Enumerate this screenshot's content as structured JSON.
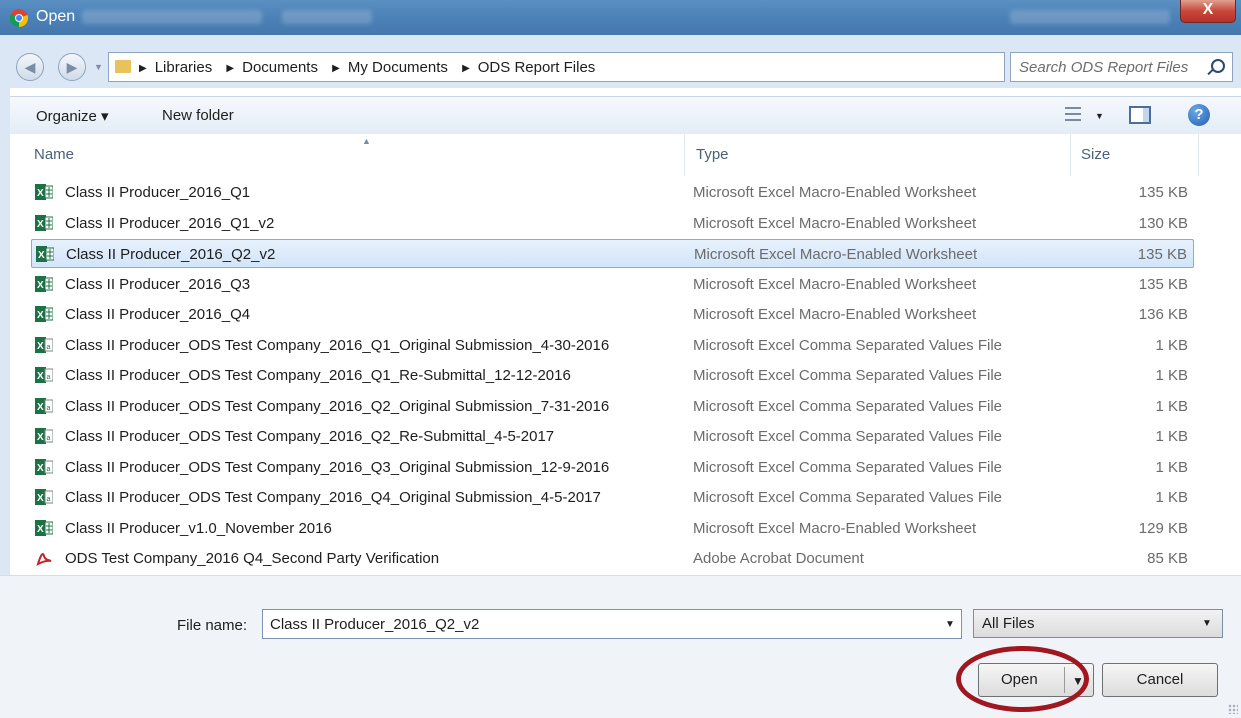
{
  "window": {
    "title": "Open",
    "title_icon": "chrome-icon",
    "close_label": "X"
  },
  "addressbar": {
    "breadcrumbs": [
      "Libraries",
      "Documents",
      "My Documents",
      "ODS Report Files"
    ],
    "search_placeholder": "Search ODS Report Files"
  },
  "commandbar": {
    "organize_label": "Organize ▾",
    "new_folder_label": "New folder"
  },
  "columns": {
    "name": "Name",
    "type": "Type",
    "size": "Size"
  },
  "files": [
    {
      "name": "Class II Producer_2016_Q1",
      "type": "Microsoft Excel Macro-Enabled Worksheet",
      "size": "135 KB",
      "icon": "excel-macro-icon"
    },
    {
      "name": "Class II Producer_2016_Q1_v2",
      "type": "Microsoft Excel Macro-Enabled Worksheet",
      "size": "130 KB",
      "icon": "excel-macro-icon"
    },
    {
      "name": "Class II Producer_2016_Q2_v2",
      "type": "Microsoft Excel Macro-Enabled Worksheet",
      "size": "135 KB",
      "icon": "excel-macro-icon",
      "selected": true
    },
    {
      "name": "Class II Producer_2016_Q3",
      "type": "Microsoft Excel Macro-Enabled Worksheet",
      "size": "135 KB",
      "icon": "excel-macro-icon"
    },
    {
      "name": "Class II Producer_2016_Q4",
      "type": "Microsoft Excel Macro-Enabled Worksheet",
      "size": "136 KB",
      "icon": "excel-macro-icon"
    },
    {
      "name": "Class II Producer_ODS Test Company_2016_Q1_Original Submission_4-30-2016",
      "type": "Microsoft Excel Comma Separated Values File",
      "size": "1 KB",
      "icon": "excel-csv-icon"
    },
    {
      "name": "Class II Producer_ODS Test Company_2016_Q1_Re-Submittal_12-12-2016",
      "type": "Microsoft Excel Comma Separated Values File",
      "size": "1 KB",
      "icon": "excel-csv-icon"
    },
    {
      "name": "Class II Producer_ODS Test Company_2016_Q2_Original Submission_7-31-2016",
      "type": "Microsoft Excel Comma Separated Values File",
      "size": "1 KB",
      "icon": "excel-csv-icon"
    },
    {
      "name": "Class II Producer_ODS Test Company_2016_Q2_Re-Submittal_4-5-2017",
      "type": "Microsoft Excel Comma Separated Values File",
      "size": "1 KB",
      "icon": "excel-csv-icon"
    },
    {
      "name": "Class II Producer_ODS Test Company_2016_Q3_Original Submission_12-9-2016",
      "type": "Microsoft Excel Comma Separated Values File",
      "size": "1 KB",
      "icon": "excel-csv-icon"
    },
    {
      "name": "Class II Producer_ODS Test Company_2016_Q4_Original Submission_4-5-2017",
      "type": "Microsoft Excel Comma Separated Values File",
      "size": "1 KB",
      "icon": "excel-csv-icon"
    },
    {
      "name": "Class II Producer_v1.0_November 2016",
      "type": "Microsoft Excel Macro-Enabled Worksheet",
      "size": "129 KB",
      "icon": "excel-macro-icon"
    },
    {
      "name": "ODS Test Company_2016 Q4_Second Party Verification",
      "type": "Adobe Acrobat Document",
      "size": "85 KB",
      "icon": "pdf-icon"
    }
  ],
  "footer": {
    "file_name_label": "File name:",
    "file_name_value": "Class II Producer_2016_Q2_v2",
    "file_type_value": "All Files",
    "open_label": "Open",
    "cancel_label": "Cancel"
  },
  "colors": {
    "highlight_ring": "#a0171f",
    "selection": "#d2e5fa",
    "titlebar": "#4a7fb5"
  }
}
